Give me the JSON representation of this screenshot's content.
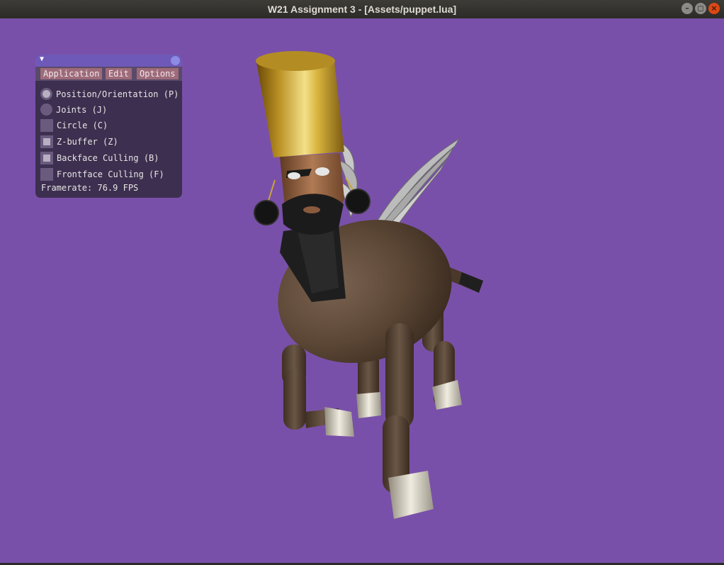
{
  "window": {
    "title": "W21 Assignment 3 - [Assets/puppet.lua]",
    "buttons": {
      "minimize": "–",
      "maximize": "◻",
      "close": "×"
    }
  },
  "panel": {
    "collapse_glyph": "▼",
    "menu": [
      "Application",
      "Edit",
      "Options"
    ],
    "modes": [
      {
        "label": "Position/Orientation (P)",
        "selected": true
      },
      {
        "label": "Joints (J)",
        "selected": false
      }
    ],
    "options": [
      {
        "label": "Circle (C)",
        "checked": false
      },
      {
        "label": "Z-buffer (Z)",
        "checked": true
      },
      {
        "label": "Backface Culling (B)",
        "checked": true
      },
      {
        "label": "Frontface Culling (F)",
        "checked": false
      }
    ],
    "framerate": "Framerate: 76.9 FPS"
  },
  "colors": {
    "background": "#7950a9",
    "body": "#5a4534",
    "hat": "#c7a62e",
    "beard": "#1e1e1e",
    "hooves": "#d9d4c4"
  }
}
